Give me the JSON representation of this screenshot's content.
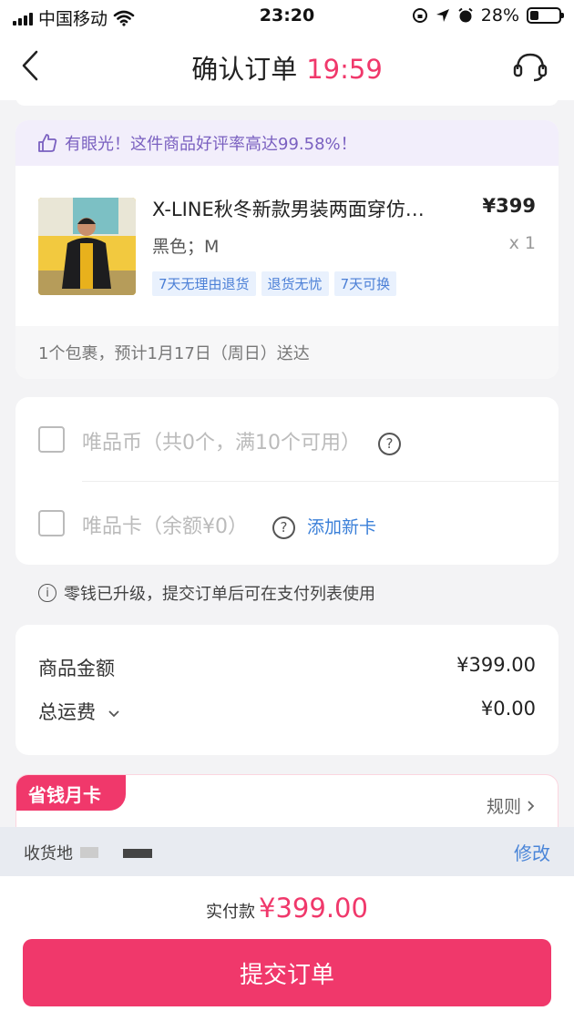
{
  "status_bar": {
    "carrier": "中国移动",
    "time": "23:20",
    "battery": "28%",
    "battery_level": 0.28
  },
  "header": {
    "title": "确认订单",
    "countdown": "19:59",
    "icons": {
      "back": "chevron-left-icon",
      "service": "headset-icon"
    }
  },
  "goods": {
    "praise": "有眼光！这件商品好评率高达99.58%！",
    "name": "X-LINE秋冬新款男装两面穿仿…",
    "price": "¥399",
    "spec": "黑色；M",
    "qty": "x 1",
    "tags": [
      "7天无理由退货",
      "退货无忧",
      "7天可换"
    ],
    "delivery": "1个包裹，预计1月17日（周日）送达"
  },
  "payment_options": {
    "coins_label": "唯品币（共0个，满10个可用）",
    "card_label": "唯品卡（余额¥0）",
    "add_card": "添加新卡",
    "help_glyph": "?"
  },
  "notice": "零钱已升级，提交订单后可在支付列表使用",
  "amount": {
    "goods_label": "商品金额",
    "goods_value": "¥399.00",
    "shipping_label": "总运费",
    "shipping_value": "¥0.00"
  },
  "month_card": {
    "badge": "省钱月卡",
    "rule": "规则"
  },
  "address_bar": {
    "label": "收货地",
    "edit": "修改"
  },
  "bottom": {
    "pay_label": "实付款",
    "pay_value": "¥399.00",
    "submit": "提交订单"
  },
  "colors": {
    "accent": "#f0386b",
    "link": "#3a7fd8",
    "praise": "#7a60c0"
  }
}
